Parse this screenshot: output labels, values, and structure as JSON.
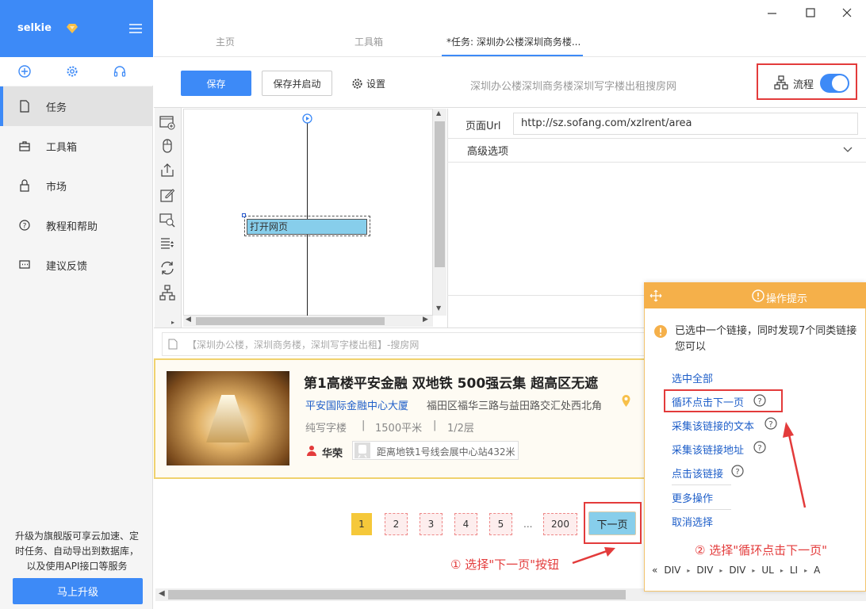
{
  "app": {
    "name": "selkie"
  },
  "sidebar": {
    "items": [
      {
        "label": "任务"
      },
      {
        "label": "工具箱"
      },
      {
        "label": "市场"
      },
      {
        "label": "教程和帮助"
      },
      {
        "label": "建议反馈"
      }
    ],
    "upgrade_text": "升级为旗舰版可享云加速、定时任务、自动导出到数据库，以及使用API接口等服务",
    "upgrade_button": "马上升级"
  },
  "tabs": [
    {
      "label": "主页"
    },
    {
      "label": "工具箱"
    },
    {
      "label": "*任务: 深圳办公楼深圳商务楼..."
    }
  ],
  "toolbar": {
    "save": "保存",
    "save_and_start": "保存并启动",
    "settings": "设置",
    "task_title": "深圳办公楼深圳商务楼深圳写字楼出租搜房网",
    "flow_label": "流程"
  },
  "flow": {
    "node_label": "打开网页"
  },
  "props": {
    "url_label": "页面Url",
    "url_value": "http://sz.sofang.com/xzlrent/area",
    "advanced": "高级选项"
  },
  "browser": {
    "address": "【深圳办公楼，深圳商务楼，深圳写字楼出租】-搜房网"
  },
  "listing": {
    "title": "第1高楼平安金融 双地铁 500强云集 超高区无遮",
    "building": "平安国际金融中心大厦",
    "address": "福田区福华三路与益田路交汇处西北角",
    "type": "纯写字楼",
    "area": "1500平米",
    "floor": "1/2层",
    "agent": "华荣",
    "metro": "距离地铁1号线会展中心站432米"
  },
  "pagination": {
    "pages": [
      "1",
      "2",
      "3",
      "4",
      "5",
      "...",
      "200"
    ],
    "next": "下一页"
  },
  "annotations": {
    "step1": "① 选择\"下一页\"按钮",
    "step2": "② 选择\"循环点击下一页\""
  },
  "tip_panel": {
    "title": "操作提示",
    "message_line1": "已选中一个链接，同时发现7个同类链接",
    "message_line2": "您可以",
    "actions": [
      "选中全部",
      "循环点击下一页",
      "采集该链接的文本",
      "采集该链接地址",
      "点击该链接",
      "更多操作",
      "取消选择"
    ],
    "breadcrumb": [
      "DIV",
      "DIV",
      "DIV",
      "UL",
      "LI",
      "A"
    ]
  },
  "colors": {
    "primary": "#3d8af7",
    "annotation_red": "#e33b3b",
    "tip_orange": "#f5b04a"
  }
}
